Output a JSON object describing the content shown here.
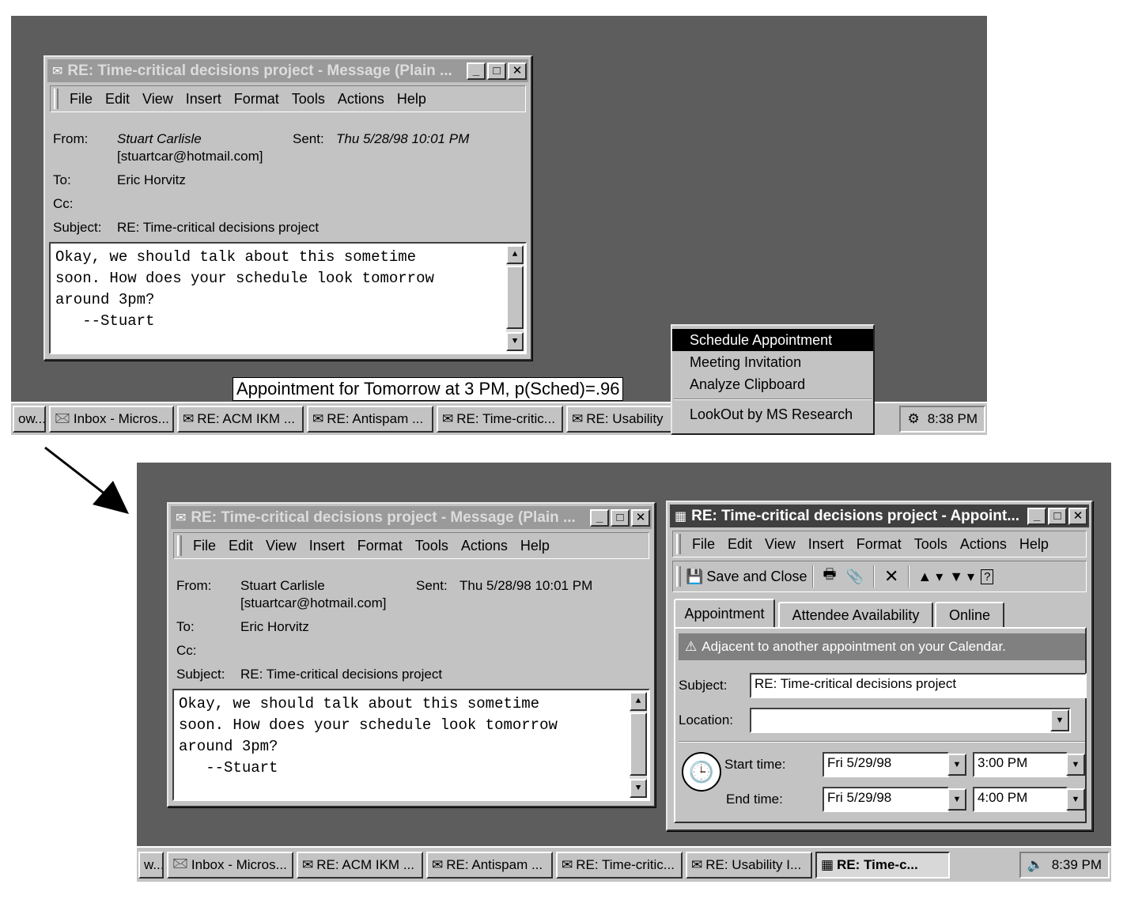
{
  "colors": {
    "desktop": "#5d5d5d",
    "face": "#c3c3c3",
    "active_title": "#404040",
    "inactive_title": "#9a9a9a",
    "menu_highlight": "#000000"
  },
  "top": {
    "message_window": {
      "title": "RE: Time-critical decisions project - Message (Plain ...",
      "menu": [
        "File",
        "Edit",
        "View",
        "Insert",
        "Format",
        "Tools",
        "Actions",
        "Help"
      ],
      "from_label": "From:",
      "from_name": "Stuart Carlisle",
      "from_email": "[stuartcar@hotmail.com]",
      "sent_label": "Sent:",
      "sent_value": "Thu 5/28/98 10:01 PM",
      "to_label": "To:",
      "to_value": "Eric Horvitz",
      "cc_label": "Cc:",
      "subject_label": "Subject:",
      "subject_value": "RE: Time-critical decisions project",
      "body": [
        "Okay, we should talk about this sometime",
        "soon. How does your schedule look tomorrow",
        "around 3pm?",
        "   --Stuart"
      ]
    },
    "tooltip": "Appointment for Tomorrow at 3 PM, p(Sched)=.96",
    "context_menu": [
      "Schedule Appointment",
      "Meeting Invitation",
      "Analyze Clipboard",
      "LookOut by MS Research"
    ],
    "taskbar": [
      "ow...",
      "Inbox - Micros...",
      "RE: ACM IKM ...",
      "RE: Antispam ...",
      "RE: Time-critic...",
      "RE: Usability"
    ],
    "clock": "8:38 PM"
  },
  "bottom": {
    "message_window": {
      "title": "RE: Time-critical decisions project - Message (Plain ...",
      "menu": [
        "File",
        "Edit",
        "View",
        "Insert",
        "Format",
        "Tools",
        "Actions",
        "Help"
      ],
      "from_label": "From:",
      "from_name": "Stuart Carlisle",
      "from_email": "[stuartcar@hotmail.com]",
      "sent_label": "Sent:",
      "sent_value": "Thu 5/28/98 10:01 PM",
      "to_label": "To:",
      "to_value": "Eric Horvitz",
      "cc_label": "Cc:",
      "subject_label": "Subject:",
      "subject_value": "RE: Time-critical decisions project",
      "body": [
        "Okay, we should talk about this sometime",
        "soon. How does your schedule look tomorrow",
        "around 3pm?",
        "   --Stuart"
      ]
    },
    "appointment_window": {
      "title": "RE: Time-critical decisions project - Appoint...",
      "menu": [
        "File",
        "Edit",
        "View",
        "Insert",
        "Format",
        "Tools",
        "Actions",
        "Help"
      ],
      "save_close": "Save and Close",
      "tabs": [
        "Appointment",
        "Attendee Availability",
        "Online"
      ],
      "warning": "Adjacent to another appointment on your Calendar.",
      "subject_label": "Subject:",
      "subject_value": "RE: Time-critical decisions project",
      "location_label": "Location:",
      "location_value": "",
      "start_label": "Start time:",
      "start_date": "Fri 5/29/98",
      "start_time": "3:00 PM",
      "end_label": "End time:",
      "end_date": "Fri 5/29/98",
      "end_time": "4:00 PM"
    },
    "taskbar": [
      "w...",
      "Inbox - Micros...",
      "RE: ACM IKM ...",
      "RE: Antispam ...",
      "RE: Time-critic...",
      "RE: Usability I...",
      "RE: Time-c..."
    ],
    "clock": "8:39 PM"
  }
}
